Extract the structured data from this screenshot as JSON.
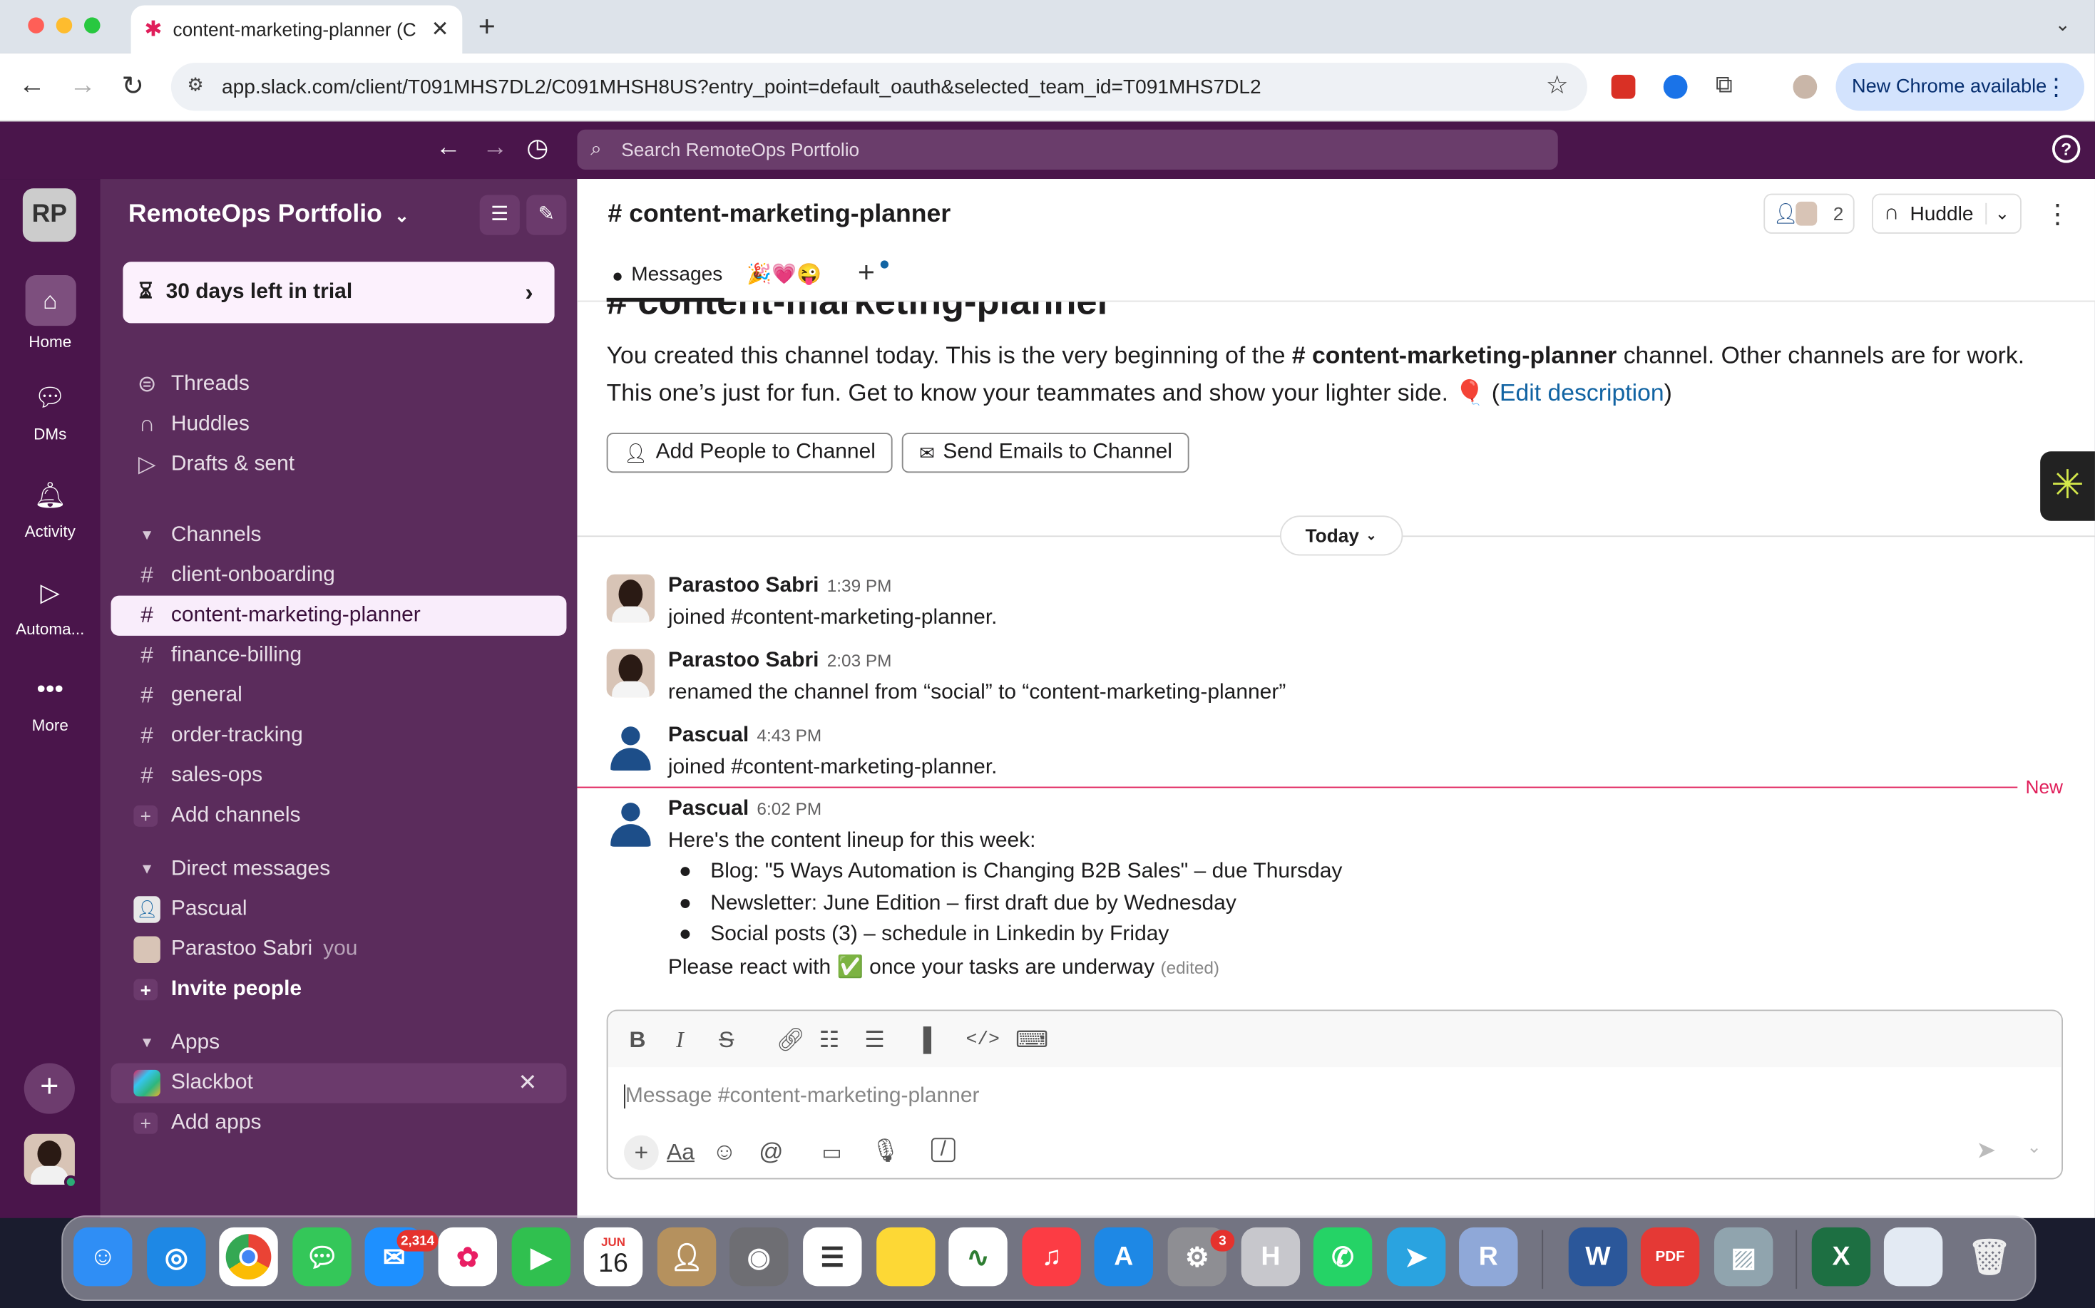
{
  "browser": {
    "tab_title": "content-marketing-planner (C",
    "url": "app.slack.com/client/T091MHS7DL2/C091MHSH8US?entry_point=default_oauth&selected_team_id=T091MHS7DL2",
    "new_chrome_label": "New Chrome available"
  },
  "topbar": {
    "search_placeholder": "Search RemoteOps Portfolio"
  },
  "rail": {
    "workspace_initials": "RP",
    "items": [
      {
        "label": "Home",
        "icon": "home-icon"
      },
      {
        "label": "DMs",
        "icon": "dms-icon"
      },
      {
        "label": "Activity",
        "icon": "bell-icon"
      },
      {
        "label": "Automa...",
        "icon": "play-icon"
      },
      {
        "label": "More",
        "icon": "more-icon"
      }
    ]
  },
  "sidebar": {
    "workspace_name": "RemoteOps Portfolio",
    "trial_label": "30 days left in trial",
    "nav": [
      "Threads",
      "Huddles",
      "Drafts & sent"
    ],
    "channels_header": "Channels",
    "channels": [
      "client-onboarding",
      "content-marketing-planner",
      "finance-billing",
      "general",
      "order-tracking",
      "sales-ops"
    ],
    "active_channel": "content-marketing-planner",
    "add_channels": "Add channels",
    "dm_header": "Direct messages",
    "dms": [
      {
        "name": "Pascual",
        "suffix": ""
      },
      {
        "name": "Parastoo Sabri",
        "suffix": "you"
      }
    ],
    "invite_people": "Invite people",
    "apps_header": "Apps",
    "apps": [
      "Slackbot"
    ],
    "add_apps": "Add apps"
  },
  "channel": {
    "header_title": "# content-marketing-planner",
    "member_count": "2",
    "huddle_label": "Huddle",
    "tab_messages": "Messages",
    "tab_emoji": "🎉💗😜",
    "intro_heading": "# content-marketing-planner",
    "intro_text_1": "You created this channel today. This is the very beginning of the",
    "intro_channel": "# content-marketing-planner",
    "intro_text_2": "channel. Other channels are for work.",
    "intro_text_3": "This one’s just for fun. Get to know your teammates and show your lighter side. 🎈 (",
    "edit_description": "Edit description",
    "intro_text_4": ")",
    "add_people_btn": "Add People to Channel",
    "send_emails_btn": "Send Emails to Channel",
    "date_divider": "Today",
    "new_label": "New"
  },
  "messages": [
    {
      "author": "Parastoo Sabri",
      "time": "1:39 PM",
      "text": "joined #content-marketing-planner."
    },
    {
      "author": "Parastoo Sabri",
      "time": "2:03 PM",
      "text": "renamed the channel from “social” to “content-marketing-planner”"
    },
    {
      "author": "Pascual",
      "time": "4:43 PM",
      "text": "joined #content-marketing-planner."
    },
    {
      "author": "Pascual",
      "time": "6:02 PM",
      "text": "Here's the content lineup for this week:"
    }
  ],
  "last_message": {
    "bullets": [
      "Blog: \"5 Ways Automation is Changing B2B Sales\" – due Thursday",
      "Newsletter: June Edition – first draft due by Wednesday",
      "Social posts (3) – schedule in Linkedin by Friday"
    ],
    "closing_1": "Please react with",
    "closing_emoji": "✅",
    "closing_2": "once your tasks are underway",
    "edited": "(edited)"
  },
  "composer": {
    "placeholder": "Message #content-marketing-planner",
    "aa_label": "Aa"
  },
  "dock": {
    "mail_badge": "2,314",
    "calendar_month": "JUN",
    "calendar_day": "16",
    "settings_badge": "3",
    "pdf_label": "PDF"
  },
  "colors": {
    "aubergine": "#4a154b",
    "sidebar": "#5b2c5c",
    "link": "#1264a3",
    "new_line": "#e01e5a"
  }
}
